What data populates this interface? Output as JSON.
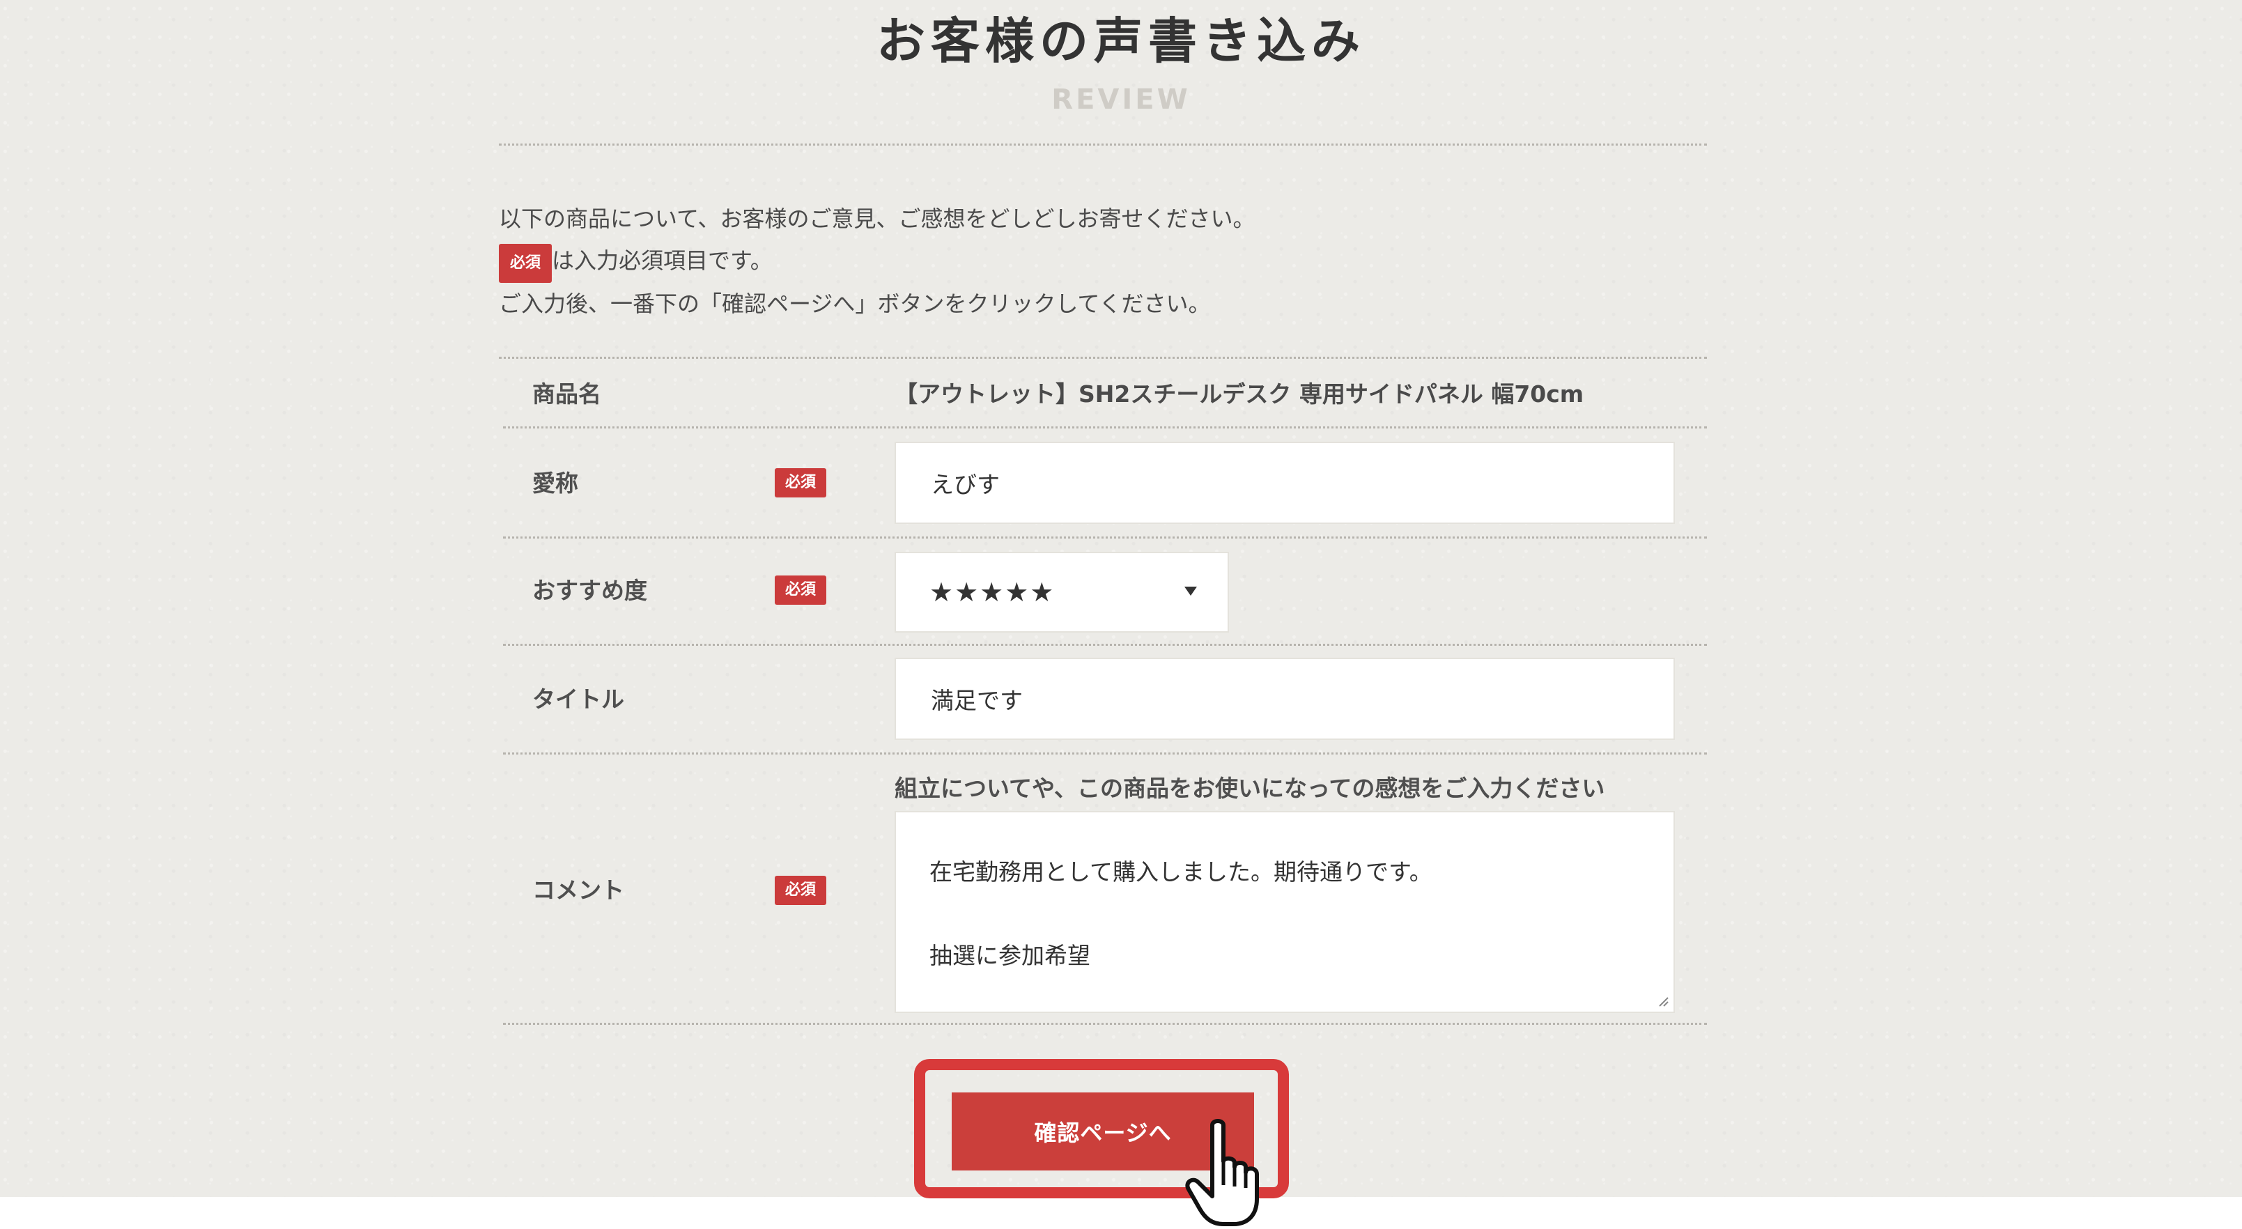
{
  "header": {
    "title": "お客様の声書き込み",
    "subtitle": "REVIEW"
  },
  "intro": {
    "line1": "以下の商品について、お客様のご意見、ご感想をどしどしお寄せください。",
    "required_badge": "必須",
    "line2": "は入力必須項目です。",
    "line3": "ご入力後、一番下の「確認ページへ」ボタンをクリックしてください。"
  },
  "form": {
    "product": {
      "label": "商品名",
      "value": "【アウトレット】SH2スチールデスク 専用サイドパネル 幅70cm"
    },
    "nickname": {
      "label": "愛称",
      "badge": "必須",
      "value": "えびす"
    },
    "rating": {
      "label": "おすすめ度",
      "badge": "必須",
      "value": "★★★★★"
    },
    "title_field": {
      "label": "タイトル",
      "value": "満足です"
    },
    "comment": {
      "label": "コメント",
      "badge": "必須",
      "hint": "組立についてや、この商品をお使いになっての感想をご入力ください",
      "line1": "在宅勤務用として購入しました。期待通りです。",
      "line2": "抽選に参加希望"
    }
  },
  "actions": {
    "confirm_label": "確認ページへ"
  },
  "icons": {
    "cursor": "hand-pointer-icon",
    "select_arrow": "caret-down-icon",
    "resize": "resize-grip-icon"
  },
  "colors": {
    "accent": "#cb3f3b",
    "highlight": "#d83a3a",
    "background": "#ecebe7"
  }
}
